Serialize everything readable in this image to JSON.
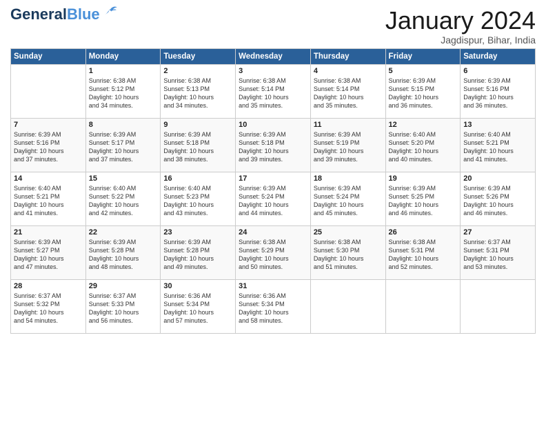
{
  "header": {
    "logo_line1": "General",
    "logo_line2": "Blue",
    "month": "January 2024",
    "location": "Jagdispur, Bihar, India"
  },
  "weekdays": [
    "Sunday",
    "Monday",
    "Tuesday",
    "Wednesday",
    "Thursday",
    "Friday",
    "Saturday"
  ],
  "weeks": [
    [
      {
        "day": "",
        "info": ""
      },
      {
        "day": "1",
        "info": "Sunrise: 6:38 AM\nSunset: 5:12 PM\nDaylight: 10 hours\nand 34 minutes."
      },
      {
        "day": "2",
        "info": "Sunrise: 6:38 AM\nSunset: 5:13 PM\nDaylight: 10 hours\nand 34 minutes."
      },
      {
        "day": "3",
        "info": "Sunrise: 6:38 AM\nSunset: 5:14 PM\nDaylight: 10 hours\nand 35 minutes."
      },
      {
        "day": "4",
        "info": "Sunrise: 6:38 AM\nSunset: 5:14 PM\nDaylight: 10 hours\nand 35 minutes."
      },
      {
        "day": "5",
        "info": "Sunrise: 6:39 AM\nSunset: 5:15 PM\nDaylight: 10 hours\nand 36 minutes."
      },
      {
        "day": "6",
        "info": "Sunrise: 6:39 AM\nSunset: 5:16 PM\nDaylight: 10 hours\nand 36 minutes."
      }
    ],
    [
      {
        "day": "7",
        "info": "Sunrise: 6:39 AM\nSunset: 5:16 PM\nDaylight: 10 hours\nand 37 minutes."
      },
      {
        "day": "8",
        "info": "Sunrise: 6:39 AM\nSunset: 5:17 PM\nDaylight: 10 hours\nand 37 minutes."
      },
      {
        "day": "9",
        "info": "Sunrise: 6:39 AM\nSunset: 5:18 PM\nDaylight: 10 hours\nand 38 minutes."
      },
      {
        "day": "10",
        "info": "Sunrise: 6:39 AM\nSunset: 5:18 PM\nDaylight: 10 hours\nand 39 minutes."
      },
      {
        "day": "11",
        "info": "Sunrise: 6:39 AM\nSunset: 5:19 PM\nDaylight: 10 hours\nand 39 minutes."
      },
      {
        "day": "12",
        "info": "Sunrise: 6:40 AM\nSunset: 5:20 PM\nDaylight: 10 hours\nand 40 minutes."
      },
      {
        "day": "13",
        "info": "Sunrise: 6:40 AM\nSunset: 5:21 PM\nDaylight: 10 hours\nand 41 minutes."
      }
    ],
    [
      {
        "day": "14",
        "info": "Sunrise: 6:40 AM\nSunset: 5:21 PM\nDaylight: 10 hours\nand 41 minutes."
      },
      {
        "day": "15",
        "info": "Sunrise: 6:40 AM\nSunset: 5:22 PM\nDaylight: 10 hours\nand 42 minutes."
      },
      {
        "day": "16",
        "info": "Sunrise: 6:40 AM\nSunset: 5:23 PM\nDaylight: 10 hours\nand 43 minutes."
      },
      {
        "day": "17",
        "info": "Sunrise: 6:39 AM\nSunset: 5:24 PM\nDaylight: 10 hours\nand 44 minutes."
      },
      {
        "day": "18",
        "info": "Sunrise: 6:39 AM\nSunset: 5:24 PM\nDaylight: 10 hours\nand 45 minutes."
      },
      {
        "day": "19",
        "info": "Sunrise: 6:39 AM\nSunset: 5:25 PM\nDaylight: 10 hours\nand 46 minutes."
      },
      {
        "day": "20",
        "info": "Sunrise: 6:39 AM\nSunset: 5:26 PM\nDaylight: 10 hours\nand 46 minutes."
      }
    ],
    [
      {
        "day": "21",
        "info": "Sunrise: 6:39 AM\nSunset: 5:27 PM\nDaylight: 10 hours\nand 47 minutes."
      },
      {
        "day": "22",
        "info": "Sunrise: 6:39 AM\nSunset: 5:28 PM\nDaylight: 10 hours\nand 48 minutes."
      },
      {
        "day": "23",
        "info": "Sunrise: 6:39 AM\nSunset: 5:28 PM\nDaylight: 10 hours\nand 49 minutes."
      },
      {
        "day": "24",
        "info": "Sunrise: 6:38 AM\nSunset: 5:29 PM\nDaylight: 10 hours\nand 50 minutes."
      },
      {
        "day": "25",
        "info": "Sunrise: 6:38 AM\nSunset: 5:30 PM\nDaylight: 10 hours\nand 51 minutes."
      },
      {
        "day": "26",
        "info": "Sunrise: 6:38 AM\nSunset: 5:31 PM\nDaylight: 10 hours\nand 52 minutes."
      },
      {
        "day": "27",
        "info": "Sunrise: 6:37 AM\nSunset: 5:31 PM\nDaylight: 10 hours\nand 53 minutes."
      }
    ],
    [
      {
        "day": "28",
        "info": "Sunrise: 6:37 AM\nSunset: 5:32 PM\nDaylight: 10 hours\nand 54 minutes."
      },
      {
        "day": "29",
        "info": "Sunrise: 6:37 AM\nSunset: 5:33 PM\nDaylight: 10 hours\nand 56 minutes."
      },
      {
        "day": "30",
        "info": "Sunrise: 6:36 AM\nSunset: 5:34 PM\nDaylight: 10 hours\nand 57 minutes."
      },
      {
        "day": "31",
        "info": "Sunrise: 6:36 AM\nSunset: 5:34 PM\nDaylight: 10 hours\nand 58 minutes."
      },
      {
        "day": "",
        "info": ""
      },
      {
        "day": "",
        "info": ""
      },
      {
        "day": "",
        "info": ""
      }
    ]
  ]
}
